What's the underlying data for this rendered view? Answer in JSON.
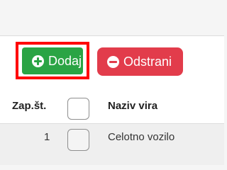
{
  "toolbar": {
    "add_label": "Dodaj",
    "remove_label": "Odstrani",
    "add_icon": "plus-circle-icon",
    "remove_icon": "minus-circle-icon"
  },
  "table": {
    "columns": [
      "Zap.št.",
      "Naziv vira"
    ],
    "rows": [
      {
        "number": "1",
        "name": "Celotno vozilo"
      }
    ]
  },
  "colors": {
    "add_button": "#2aa444",
    "remove_button": "#e23c4b",
    "highlight_border": "#ff0000"
  }
}
